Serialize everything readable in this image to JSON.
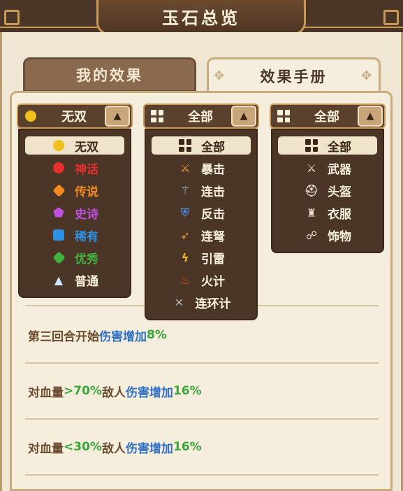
{
  "header": {
    "title": "玉石总览"
  },
  "tabs": [
    {
      "label": "我的效果",
      "active": false
    },
    {
      "label": "效果手册",
      "active": true
    }
  ],
  "filters": {
    "rarity": {
      "selected": "无双",
      "items": [
        {
          "label": "无双",
          "color": "#f0c020",
          "icon": "yellow-gem-icon",
          "selected": true
        },
        {
          "label": "神话",
          "color": "#e53030",
          "icon": "red-gem-icon"
        },
        {
          "label": "传说",
          "color": "#f08a20",
          "icon": "orange-gem-icon"
        },
        {
          "label": "史诗",
          "color": "#c050e0",
          "icon": "purple-gem-icon"
        },
        {
          "label": "稀有",
          "color": "#3090e0",
          "icon": "blue-gem-icon"
        },
        {
          "label": "优秀",
          "color": "#40b040",
          "icon": "green-gem-icon"
        },
        {
          "label": "普通",
          "color": "#f3e7d1",
          "icon": "white-gem-icon"
        }
      ]
    },
    "effect_type": {
      "selected": "全部",
      "items": [
        {
          "label": "全部",
          "icon": "grid-icon",
          "selected": true
        },
        {
          "label": "暴击",
          "icon": "critical-strike-icon"
        },
        {
          "label": "连击",
          "icon": "combo-icon"
        },
        {
          "label": "反击",
          "icon": "counter-icon"
        },
        {
          "label": "连弩",
          "icon": "crossbow-icon"
        },
        {
          "label": "引雷",
          "icon": "lightning-icon"
        },
        {
          "label": "火计",
          "icon": "fire-icon"
        },
        {
          "label": "连环计",
          "icon": "chain-icon"
        }
      ]
    },
    "equipment": {
      "selected": "全部",
      "items": [
        {
          "label": "全部",
          "icon": "grid-icon",
          "selected": true
        },
        {
          "label": "武器",
          "icon": "sword-icon"
        },
        {
          "label": "头盔",
          "icon": "helmet-icon"
        },
        {
          "label": "衣服",
          "icon": "armor-icon"
        },
        {
          "label": "饰物",
          "icon": "accessory-icon"
        }
      ]
    }
  },
  "effects": [
    {
      "parts": [
        "第三回合开始",
        "伤害增加",
        "8%"
      ]
    },
    {
      "parts": [
        "对血量",
        ">70%",
        "敌人",
        "伤害增加",
        "16%"
      ]
    },
    {
      "parts": [
        "对血量",
        "<30%",
        "敌人",
        "伤害增加",
        "16%"
      ]
    }
  ],
  "colors": {
    "brown_text": "#6b4a30",
    "blue_text": "#2f6fc4",
    "green_text": "#3aa43a"
  }
}
